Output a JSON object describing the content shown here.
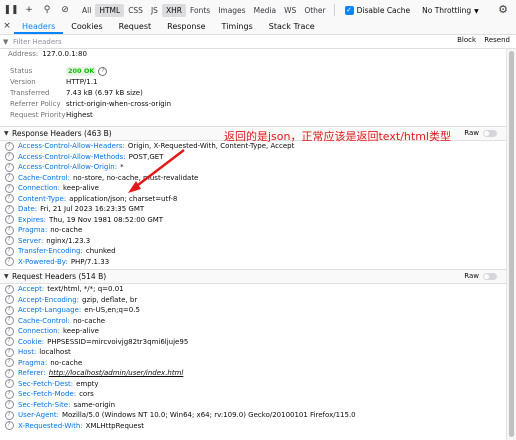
{
  "toolbar": {
    "filters": [
      "All",
      "HTML",
      "CSS",
      "JS",
      "XHR",
      "Fonts",
      "Images",
      "Media",
      "WS",
      "Other"
    ],
    "disable_cache_label": "Disable Cache",
    "throttling_label": "No Throttling"
  },
  "panel_tabs": [
    "Headers",
    "Cookies",
    "Request",
    "Response",
    "Timings",
    "Stack Trace"
  ],
  "filter": {
    "placeholder": "Filter Headers",
    "block_label": "Block",
    "resend_label": "Resend"
  },
  "summary": {
    "address_label": "Address:",
    "address_value": "127.0.0.1:80",
    "rows": [
      {
        "k": "Status",
        "v": "200 OK"
      },
      {
        "k": "Version",
        "v": "HTTP/1.1"
      },
      {
        "k": "Transferred",
        "v": "7.43 kB (6.97 kB size)"
      },
      {
        "k": "Referrer Policy",
        "v": "strict-origin-when-cross-origin"
      },
      {
        "k": "Request Priority",
        "v": "Highest"
      }
    ]
  },
  "response_headers": {
    "title": "Response Headers (463 B)",
    "raw_label": "Raw",
    "items": [
      {
        "n": "Access-Control-Allow-Headers:",
        "v": "Origin, X-Requested-With, Content-Type, Accept"
      },
      {
        "n": "Access-Control-Allow-Methods:",
        "v": "POST,GET"
      },
      {
        "n": "Access-Control-Allow-Origin:",
        "v": "*"
      },
      {
        "n": "Cache-Control:",
        "v": "no-store, no-cache, must-revalidate"
      },
      {
        "n": "Connection:",
        "v": "keep-alive"
      },
      {
        "n": "Content-Type:",
        "v": "application/json; charset=utf-8"
      },
      {
        "n": "Date:",
        "v": "Fri, 21 Jul 2023 16:23:35 GMT"
      },
      {
        "n": "Expires:",
        "v": "Thu, 19 Nov 1981 08:52:00 GMT"
      },
      {
        "n": "Pragma:",
        "v": "no-cache"
      },
      {
        "n": "Server:",
        "v": "nginx/1.23.3"
      },
      {
        "n": "Transfer-Encoding:",
        "v": "chunked"
      },
      {
        "n": "X-Powered-By:",
        "v": "PHP/7.1.33"
      }
    ]
  },
  "request_headers": {
    "title": "Request Headers (514 B)",
    "raw_label": "Raw",
    "items": [
      {
        "n": "Accept:",
        "v": "text/html, */*; q=0.01"
      },
      {
        "n": "Accept-Encoding:",
        "v": "gzip, deflate, br"
      },
      {
        "n": "Accept-Language:",
        "v": "en-US,en;q=0.5"
      },
      {
        "n": "Cache-Control:",
        "v": "no-cache"
      },
      {
        "n": "Connection:",
        "v": "keep-alive"
      },
      {
        "n": "Cookie:",
        "v": "PHPSESSID=mircvoivjg82tr3qmi6ljuje95"
      },
      {
        "n": "Host:",
        "v": "localhost"
      },
      {
        "n": "Pragma:",
        "v": "no-cache"
      },
      {
        "n": "Referer:",
        "v": "http://localhost/admin/user/index.html"
      },
      {
        "n": "Sec-Fetch-Dest:",
        "v": "empty"
      },
      {
        "n": "Sec-Fetch-Mode:",
        "v": "cors"
      },
      {
        "n": "Sec-Fetch-Site:",
        "v": "same-origin"
      },
      {
        "n": "User-Agent:",
        "v": "Mozilla/5.0 (Windows NT 10.0; Win64; x64; rv:109.0) Gecko/20100101 Firefox/115.0"
      },
      {
        "n": "X-Requested-With:",
        "v": "XMLHttpRequest"
      }
    ]
  },
  "annotation": {
    "text": "返回的是json，正常应该是返回text/html类型",
    "color": "#e31818"
  }
}
